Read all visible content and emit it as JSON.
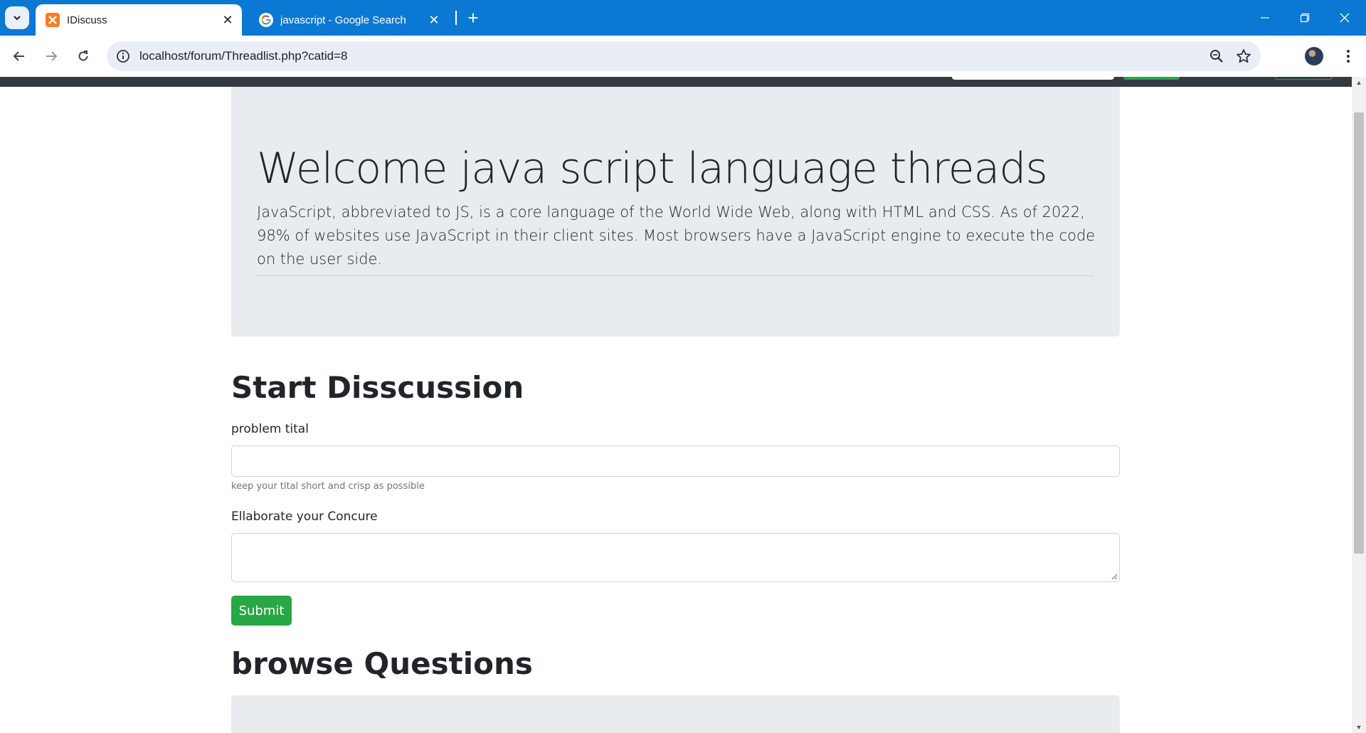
{
  "browser": {
    "tabs": [
      {
        "title": "IDiscuss",
        "icon": "xampp-icon",
        "active": true
      },
      {
        "title": "javascript - Google Search",
        "icon": "google-icon",
        "active": false
      }
    ],
    "url": "localhost/forum/Threadlist.php?catid=8",
    "new_tab_label": "+",
    "close_label": "✕"
  },
  "jumbotron": {
    "title": "Welcome java script language threads",
    "description": "JavaScript, abbreviated to JS, is a core language of the World Wide Web, along with HTML and CSS. As of 2022, 98% of websites use JavaScript in their client sites. Most browsers have a JavaScript engine to execute the code on the user side."
  },
  "form": {
    "heading": "Start Disscussion",
    "title_label": "problem tital",
    "title_value": "",
    "title_help": "keep your tital short and crisp as possible",
    "concern_label": "Ellaborate your Concure",
    "concern_value": "",
    "submit_label": "Submit"
  },
  "browse": {
    "heading": "browse Questions"
  },
  "colors": {
    "chrome_accent": "#0b78d4",
    "success": "#28a745",
    "jumbotron_bg": "#e9ecef",
    "navbar_dark": "#343a40"
  }
}
